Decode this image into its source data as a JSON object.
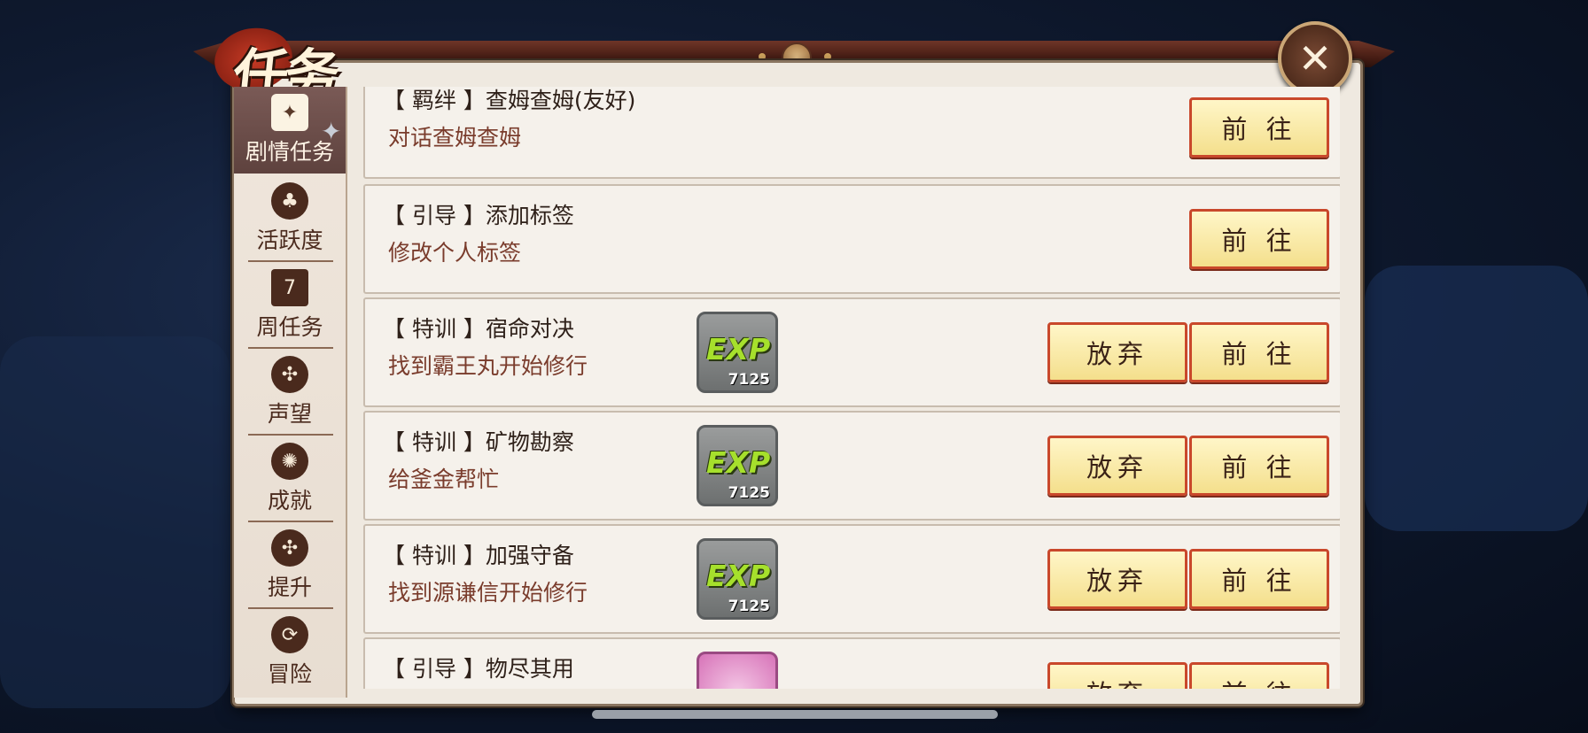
{
  "header": {
    "title": "任务",
    "close_label": "✕"
  },
  "sidebar": {
    "items": [
      {
        "label": "剧情任务",
        "icon": "scroll-icon",
        "active": true
      },
      {
        "label": "活跃度",
        "icon": "clover-icon"
      },
      {
        "label": "周任务",
        "icon": "calendar-icon",
        "glyph": "7"
      },
      {
        "label": "声望",
        "icon": "emblem-icon"
      },
      {
        "label": "成就",
        "icon": "swirl-icon"
      },
      {
        "label": "提升",
        "icon": "upgrade-icon"
      },
      {
        "label": "冒险",
        "icon": "adventure-icon"
      }
    ]
  },
  "quests": [
    {
      "title": "【 羁绊 】查姆查姆(友好)",
      "desc": "对话查姆查姆",
      "reward": null,
      "abandon": null,
      "go": "前 往"
    },
    {
      "title": "【 引导 】添加标签",
      "desc": "修改个人标签",
      "reward": null,
      "abandon": null,
      "go": "前 往"
    },
    {
      "title": "【 特训 】宿命对决",
      "desc": "找到霸王丸开始修行",
      "reward": {
        "label": "EXP",
        "count": "7125"
      },
      "abandon": "放弃",
      "go": "前 往"
    },
    {
      "title": "【 特训 】矿物勘察",
      "desc": "给釜金帮忙",
      "reward": {
        "label": "EXP",
        "count": "7125"
      },
      "abandon": "放弃",
      "go": "前 往"
    },
    {
      "title": "【 特训 】加强守备",
      "desc": "找到源谦信开始修行",
      "reward": {
        "label": "EXP",
        "count": "7125"
      },
      "abandon": "放弃",
      "go": "前 往"
    },
    {
      "title": "【 引导 】物尽其用",
      "desc": "",
      "reward": {
        "label": "",
        "count": ""
      },
      "abandon": "放弃",
      "go": "前 往"
    }
  ]
}
